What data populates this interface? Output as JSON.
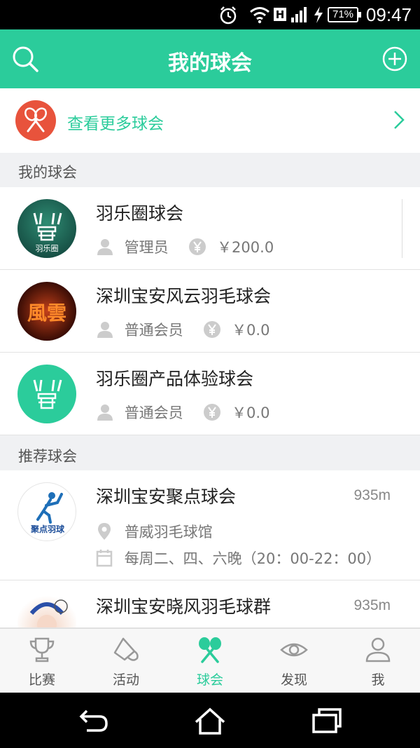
{
  "status_bar": {
    "time": "09:47",
    "battery": "71%"
  },
  "header": {
    "title": "我的球会"
  },
  "more_clubs": {
    "label": "查看更多球会"
  },
  "sections": {
    "my_clubs": "我的球会",
    "recommended": "推荐球会"
  },
  "my_clubs": [
    {
      "name": "羽乐圈球会",
      "role": "管理员",
      "balance": "￥200.0",
      "avatar_text": "羽乐圈"
    },
    {
      "name": "深圳宝安风云羽毛球会",
      "role": "普通会员",
      "balance": "￥0.0",
      "avatar_text": "風雲"
    },
    {
      "name": "羽乐圈产品体验球会",
      "role": "普通会员",
      "balance": "￥0.0"
    }
  ],
  "recommended_clubs": [
    {
      "name": "深圳宝安聚点球会",
      "distance": "935m",
      "venue": "普威羽毛球馆",
      "schedule": "每周二、四、六晚（20：00-22：00）",
      "avatar_text": "聚点羽球"
    },
    {
      "name": "深圳宝安晓风羽毛球群",
      "distance": "935m"
    }
  ],
  "tabbar": {
    "tabs": [
      {
        "label": "比赛",
        "icon": "trophy-icon"
      },
      {
        "label": "活动",
        "icon": "shuttlecock-icon"
      },
      {
        "label": "球会",
        "icon": "crossed-rackets-icon"
      },
      {
        "label": "发现",
        "icon": "eye-icon"
      },
      {
        "label": "我",
        "icon": "person-icon"
      }
    ],
    "active": "球会"
  },
  "colors": {
    "accent": "#2bcc9b",
    "header_bg": "#2bcc9b",
    "more_logo": "#e8533c"
  }
}
